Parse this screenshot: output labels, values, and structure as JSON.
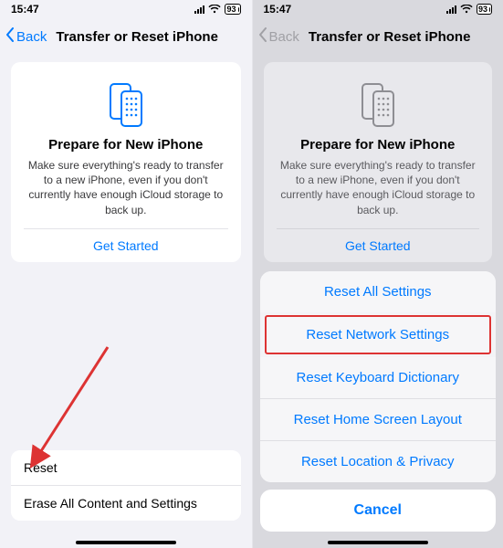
{
  "status": {
    "time": "15:47",
    "battery": "93"
  },
  "nav": {
    "back_label": "Back",
    "title": "Transfer or Reset iPhone"
  },
  "card": {
    "title": "Prepare for New iPhone",
    "desc": "Make sure everything's ready to transfer to a new iPhone, even if you don't currently have enough iCloud storage to back up.",
    "get_started": "Get Started"
  },
  "bottom": {
    "reset": "Reset",
    "erase": "Erase All Content and Settings"
  },
  "sheet": {
    "items": [
      "Reset All Settings",
      "Reset Network Settings",
      "Reset Keyboard Dictionary",
      "Reset Home Screen Layout",
      "Reset Location & Privacy"
    ],
    "cancel": "Cancel"
  },
  "colors": {
    "link": "#007aff",
    "bg": "#f2f2f7",
    "highlight_border": "#d33"
  }
}
